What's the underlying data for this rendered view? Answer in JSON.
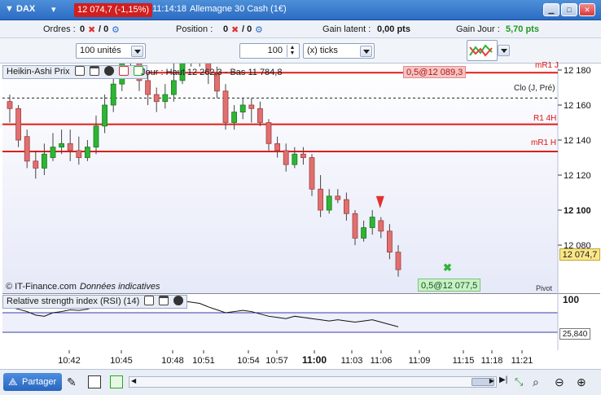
{
  "window": {
    "symbol": "DAX",
    "price_badge": "12 074,7 (-1,15%)",
    "time": "11:14:18",
    "instrument": "Allemagne 30 Cash (1€)"
  },
  "positions_bar": {
    "orders_label": "Ordres :",
    "orders_value": "0",
    "orders_value2": "/ 0",
    "position_label": "Position :",
    "position_value": "0",
    "position_value2": "/ 0",
    "latent_label": "Gain latent :",
    "latent_value": "0,00 pts",
    "day_label": "Gain Jour :",
    "day_value": "5,70 pts"
  },
  "order_bar": {
    "quantity": "100 unités",
    "ticks_value": "100",
    "ticks_unit": "(x) ticks"
  },
  "price_panel": {
    "title": "Heikin-Ashi Prix",
    "day_info": "Jour : Haut 12 262,3 - Bas 11 784,8",
    "order_label": "0,5@12 089,3",
    "bottom_order_label": "0,5@12 077,5",
    "copyright": "© IT-Finance.com",
    "data_note": "Données indicatives",
    "last_price": "12 074,7",
    "line_labels": {
      "mr1j": "mR1 J",
      "clo": "Clo (J, Pré)",
      "r14h": "R1 4H",
      "mr1h": "mR1 H",
      "pivot": "Pivot"
    }
  },
  "rsi_panel": {
    "title": "Relative strength index (RSI) (14)",
    "level_100": "100",
    "last_value": "25,840"
  },
  "bottom": {
    "share_label": "Partager"
  },
  "colors": {
    "up": "#2db534",
    "down": "#e07070",
    "resistance": "#e11d1d",
    "chart_bg_top": "#ffffff",
    "chart_bg_bottom": "#e9ebf8",
    "title_bar": "#2b6cc4"
  },
  "chart_data": {
    "type": "candlestick",
    "price_axis": {
      "ticks": [
        "12 180",
        "12 160",
        "12 140",
        "12 120",
        "12 100",
        "12 080"
      ],
      "range": [
        12060,
        12200
      ]
    },
    "time_axis": [
      "10:42",
      "10:45",
      "10:48",
      "10:51",
      "10:54",
      "10:57",
      "11:00",
      "11:03",
      "11:06",
      "11:09",
      "11:15",
      "11:18",
      "11:21"
    ],
    "levels": [
      {
        "name": "mR1 J",
        "value": 12178.5
      },
      {
        "name": "Clo (J, Pré)",
        "value": 12164
      },
      {
        "name": "R1 4H",
        "value": 12149
      },
      {
        "name": "mR1 H",
        "value": 12133.5
      }
    ],
    "candles": [
      {
        "o": 12162,
        "c": 12158,
        "h": 12166,
        "l": 12150
      },
      {
        "o": 12158,
        "c": 12140,
        "h": 12160,
        "l": 12136
      },
      {
        "o": 12142,
        "c": 12128,
        "h": 12146,
        "l": 12124
      },
      {
        "o": 12128,
        "c": 12124,
        "h": 12134,
        "l": 12118
      },
      {
        "o": 12124,
        "c": 12132,
        "h": 12138,
        "l": 12120
      },
      {
        "o": 12130,
        "c": 12136,
        "h": 12144,
        "l": 12128
      },
      {
        "o": 12136,
        "c": 12138,
        "h": 12146,
        "l": 12132
      },
      {
        "o": 12138,
        "c": 12134,
        "h": 12146,
        "l": 12128
      },
      {
        "o": 12134,
        "c": 12130,
        "h": 12142,
        "l": 12126
      },
      {
        "o": 12130,
        "c": 12136,
        "h": 12140,
        "l": 12128
      },
      {
        "o": 12136,
        "c": 12148,
        "h": 12154,
        "l": 12132
      },
      {
        "o": 12148,
        "c": 12160,
        "h": 12166,
        "l": 12144
      },
      {
        "o": 12160,
        "c": 12172,
        "h": 12180,
        "l": 12156
      },
      {
        "o": 12172,
        "c": 12186,
        "h": 12192,
        "l": 12168
      },
      {
        "o": 12186,
        "c": 12184,
        "h": 12192,
        "l": 12176
      },
      {
        "o": 12184,
        "c": 12174,
        "h": 12190,
        "l": 12168
      },
      {
        "o": 12174,
        "c": 12166,
        "h": 12178,
        "l": 12160
      },
      {
        "o": 12166,
        "c": 12162,
        "h": 12170,
        "l": 12156
      },
      {
        "o": 12162,
        "c": 12166,
        "h": 12172,
        "l": 12158
      },
      {
        "o": 12166,
        "c": 12174,
        "h": 12186,
        "l": 12162
      },
      {
        "o": 12174,
        "c": 12186,
        "h": 12196,
        "l": 12172
      },
      {
        "o": 12186,
        "c": 12190,
        "h": 12198,
        "l": 12182
      },
      {
        "o": 12190,
        "c": 12188,
        "h": 12196,
        "l": 12182
      },
      {
        "o": 12188,
        "c": 12178,
        "h": 12192,
        "l": 12172
      },
      {
        "o": 12178,
        "c": 12168,
        "h": 12182,
        "l": 12164
      },
      {
        "o": 12168,
        "c": 12150,
        "h": 12172,
        "l": 12146
      },
      {
        "o": 12150,
        "c": 12156,
        "h": 12160,
        "l": 12146
      },
      {
        "o": 12156,
        "c": 12160,
        "h": 12164,
        "l": 12152
      },
      {
        "o": 12160,
        "c": 12158,
        "h": 12164,
        "l": 12150
      },
      {
        "o": 12158,
        "c": 12150,
        "h": 12162,
        "l": 12148
      },
      {
        "o": 12150,
        "c": 12138,
        "h": 12152,
        "l": 12134
      },
      {
        "o": 12138,
        "c": 12134,
        "h": 12142,
        "l": 12130
      },
      {
        "o": 12134,
        "c": 12126,
        "h": 12138,
        "l": 12122
      },
      {
        "o": 12126,
        "c": 12132,
        "h": 12136,
        "l": 12124
      },
      {
        "o": 12132,
        "c": 12130,
        "h": 12136,
        "l": 12126
      },
      {
        "o": 12130,
        "c": 12112,
        "h": 12132,
        "l": 12108
      },
      {
        "o": 12112,
        "c": 12100,
        "h": 12120,
        "l": 12096
      },
      {
        "o": 12100,
        "c": 12108,
        "h": 12112,
        "l": 12098
      },
      {
        "o": 12108,
        "c": 12106,
        "h": 12112,
        "l": 12104
      },
      {
        "o": 12106,
        "c": 12098,
        "h": 12110,
        "l": 12094
      },
      {
        "o": 12098,
        "c": 12084,
        "h": 12100,
        "l": 12080
      },
      {
        "o": 12084,
        "c": 12090,
        "h": 12094,
        "l": 12082
      },
      {
        "o": 12090,
        "c": 12096,
        "h": 12100,
        "l": 12086
      },
      {
        "o": 12094,
        "c": 12088,
        "h": 12096,
        "l": 12084
      },
      {
        "o": 12088,
        "c": 12076,
        "h": 12092,
        "l": 12072
      },
      {
        "o": 12076,
        "c": 12066,
        "h": 12080,
        "l": 12062
      }
    ],
    "rsi": [
      60,
      56,
      52,
      46,
      44,
      50,
      52,
      55,
      54,
      56,
      62,
      66,
      70,
      74,
      72,
      68,
      62,
      58,
      60,
      64,
      70,
      68,
      66,
      60,
      55,
      50,
      52,
      54,
      52,
      48,
      44,
      42,
      40,
      44,
      42,
      40,
      38,
      36,
      38,
      36,
      34,
      36,
      38,
      34,
      30,
      26
    ]
  }
}
